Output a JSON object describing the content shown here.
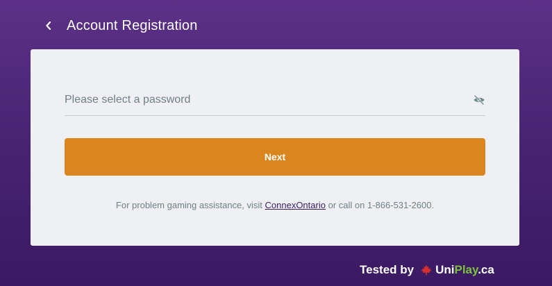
{
  "header": {
    "title": "Account Registration",
    "back_icon": "chevron-left-icon"
  },
  "form": {
    "password_placeholder": "Please select a password",
    "password_value": "",
    "visibility_icon": "eye-off-icon",
    "next_label": "Next"
  },
  "help": {
    "prefix": "For problem gaming assistance, visit ",
    "link_text": "ConnexOntario",
    "suffix": " or call on 1-866-531-2600."
  },
  "footer": {
    "tested_label": "Tested by",
    "brand_uni": "Uni",
    "brand_play": "Play",
    "brand_ca": ".ca",
    "brand_icon": "maple-leaf-icon"
  },
  "colors": {
    "background_top": "#5c3187",
    "background_bottom": "#3a1a62",
    "card": "#eef0f3",
    "accent_button": "#d9861f",
    "link": "#3b1e66",
    "brand_green": "#7cc242",
    "brand_red": "#d32f2f"
  }
}
